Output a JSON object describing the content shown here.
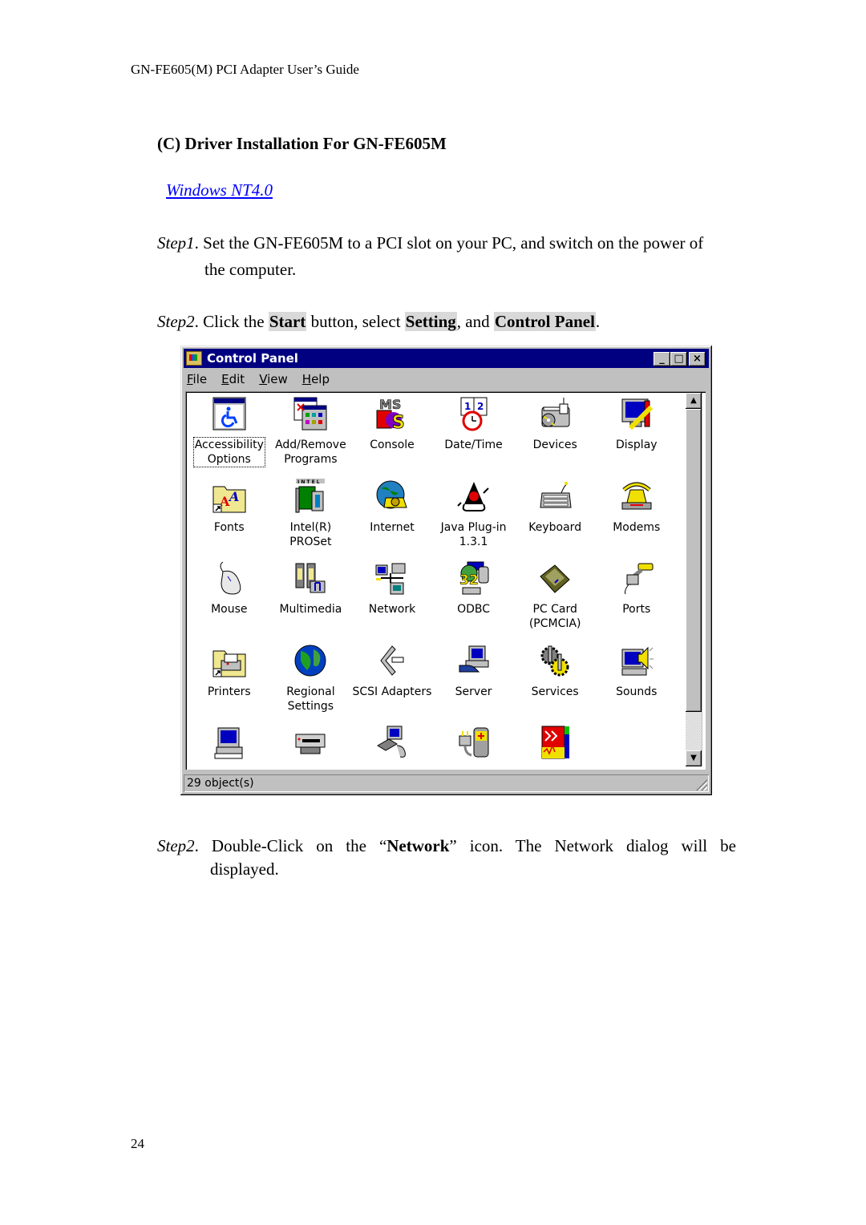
{
  "page": {
    "header": "GN-FE605(M) PCI Adapter User’s Guide",
    "section_title": "(C) Driver Installation For GN-FE605M",
    "os_link": "Windows NT4.0",
    "step1": {
      "label": "Step1",
      "text_line1": ". Set the GN-FE605M to a PCI slot on your PC, and switch on the power of",
      "text_line2": "the computer."
    },
    "step2a": {
      "label": "Step2",
      "t1": ". Click the ",
      "b1": "Start",
      "t2": " button, select ",
      "b2": "Setting",
      "t3": ", and ",
      "b3": "Control Panel",
      "t4": "."
    },
    "step2b": {
      "label": "Step2",
      "t1": ".  Double-Click  on  the  “",
      "b1": "Network",
      "t2": "”  icon.  The  Network  dialog  will  be",
      "line2": "displayed."
    },
    "page_number": "24"
  },
  "window": {
    "title": "Control Panel",
    "buttons": {
      "minimize": "_",
      "maximize": "□",
      "close": "×"
    },
    "menu": [
      {
        "accel": "F",
        "rest": "ile"
      },
      {
        "accel": "E",
        "rest": "dit"
      },
      {
        "accel": "V",
        "rest": "iew"
      },
      {
        "accel": "H",
        "rest": "elp"
      }
    ],
    "items": [
      {
        "label": "Accessibility\nOptions",
        "icon": "accessibility-icon",
        "selected": true
      },
      {
        "label": "Add/Remove\nPrograms",
        "icon": "add-remove-programs-icon"
      },
      {
        "label": "Console",
        "icon": "console-icon"
      },
      {
        "label": "Date/Time",
        "icon": "date-time-icon"
      },
      {
        "label": "Devices",
        "icon": "devices-icon"
      },
      {
        "label": "Display",
        "icon": "display-icon"
      },
      {
        "label": "Fonts",
        "icon": "fonts-icon"
      },
      {
        "label": "Intel(R)\nPROSet",
        "icon": "intel-proset-icon"
      },
      {
        "label": "Internet",
        "icon": "internet-icon"
      },
      {
        "label": "Java Plug-in\n1.3.1",
        "icon": "java-plugin-icon"
      },
      {
        "label": "Keyboard",
        "icon": "keyboard-icon"
      },
      {
        "label": "Modems",
        "icon": "modems-icon"
      },
      {
        "label": "Mouse",
        "icon": "mouse-icon"
      },
      {
        "label": "Multimedia",
        "icon": "multimedia-icon"
      },
      {
        "label": "Network",
        "icon": "network-icon"
      },
      {
        "label": "ODBC",
        "icon": "odbc-icon"
      },
      {
        "label": "PC Card\n(PCMCIA)",
        "icon": "pc-card-icon"
      },
      {
        "label": "Ports",
        "icon": "ports-icon"
      },
      {
        "label": "Printers",
        "icon": "printers-icon"
      },
      {
        "label": "Regional\nSettings",
        "icon": "regional-settings-icon"
      },
      {
        "label": "SCSI Adapters",
        "icon": "scsi-adapters-icon"
      },
      {
        "label": "Server",
        "icon": "server-icon"
      },
      {
        "label": "Services",
        "icon": "services-icon"
      },
      {
        "label": "Sounds",
        "icon": "sounds-icon"
      },
      {
        "label": "",
        "icon": "system-icon"
      },
      {
        "label": "",
        "icon": "tape-devices-icon"
      },
      {
        "label": "",
        "icon": "telephony-icon"
      },
      {
        "label": "",
        "icon": "ups-icon"
      },
      {
        "label": "",
        "icon": "app-icon"
      }
    ],
    "status": "29 object(s)"
  }
}
